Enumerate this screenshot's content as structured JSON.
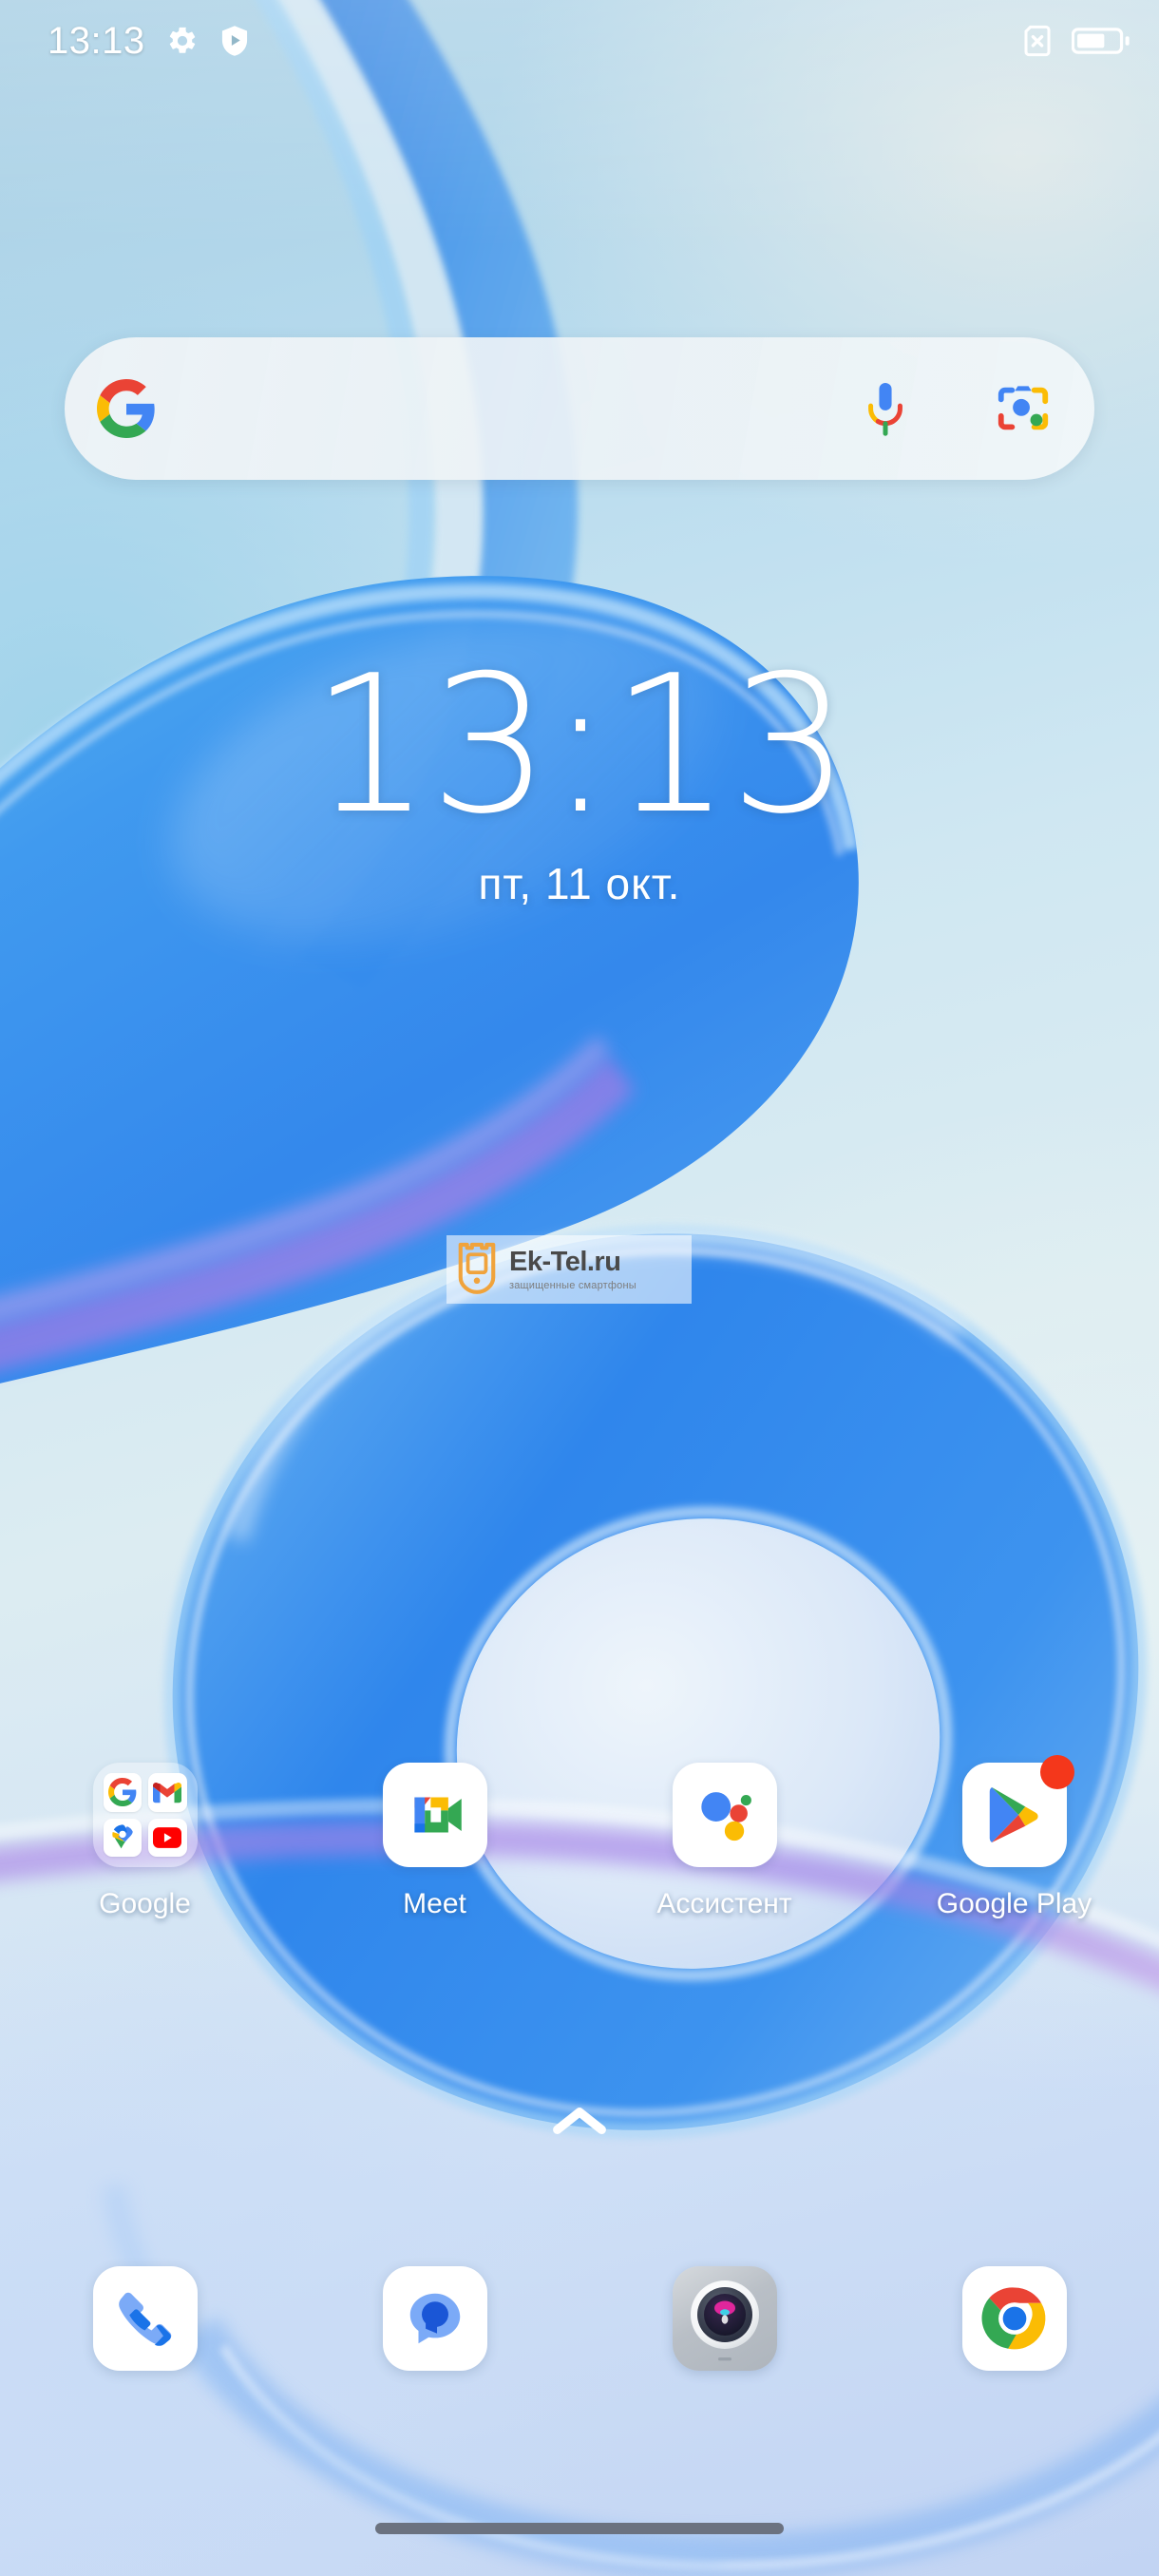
{
  "status_bar": {
    "time": "13:13",
    "left_icons": [
      {
        "name": "settings-gear-icon",
        "label": "Settings"
      },
      {
        "name": "play-protect-shield-icon",
        "label": "Play Protect"
      }
    ],
    "right_icons": [
      {
        "name": "no-sim-card-icon",
        "label": "No SIM card"
      },
      {
        "name": "battery-icon",
        "label": "Battery",
        "level_percent": 65
      }
    ]
  },
  "search": {
    "placeholder": "",
    "value": "",
    "google_logo_icon": "google-g-icon",
    "mic_icon": "microphone-icon",
    "lens_icon": "google-lens-icon"
  },
  "clock_widget": {
    "time": "13:13",
    "date": "пт, 11 окт."
  },
  "watermark": {
    "logo_icon": "ektel-shield-phone-icon",
    "title": "Ek-Tel.ru",
    "subtitle": "защищенные смартфоны"
  },
  "app_grid": [
    {
      "name": "google-folder",
      "label": "Google",
      "type": "folder",
      "items": [
        {
          "name": "google-search-icon",
          "label": "Google"
        },
        {
          "name": "gmail-icon",
          "label": "Gmail"
        },
        {
          "name": "google-maps-icon",
          "label": "Maps"
        },
        {
          "name": "youtube-icon",
          "label": "YouTube"
        }
      ]
    },
    {
      "name": "meet-app",
      "label": "Meet",
      "type": "app",
      "icon": "google-meet-icon",
      "badge": false
    },
    {
      "name": "assistant-app",
      "label": "Ассистент",
      "type": "app",
      "icon": "google-assistant-icon",
      "badge": false
    },
    {
      "name": "google-play-app",
      "label": "Google Play",
      "type": "app",
      "icon": "google-play-icon",
      "badge": true
    }
  ],
  "drawer": {
    "chevron_icon": "chevron-up-icon"
  },
  "dock": [
    {
      "name": "phone-app",
      "icon": "phone-handset-icon",
      "label": "Phone"
    },
    {
      "name": "messages-app",
      "icon": "messages-bubble-icon",
      "label": "Messages"
    },
    {
      "name": "camera-app",
      "icon": "camera-lens-icon",
      "label": "Camera"
    },
    {
      "name": "chrome-app",
      "icon": "chrome-icon",
      "label": "Chrome"
    }
  ],
  "navigation": {
    "gesture_pill": "home-gesture-pill"
  },
  "colors": {
    "google_blue": "#4285F4",
    "google_red": "#EA4335",
    "google_yellow": "#FBBC04",
    "google_green": "#34A853",
    "badge_red": "#F4371B",
    "nav_pill": "#6B7280"
  }
}
